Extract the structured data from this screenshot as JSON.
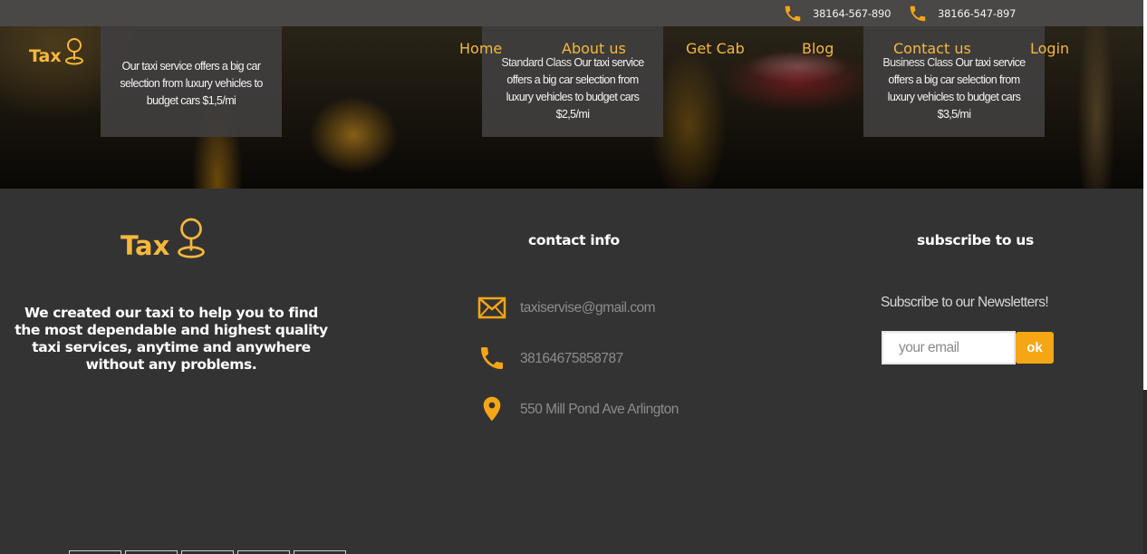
{
  "colors": {
    "accent": "#f5b83c",
    "button": "#f5a614",
    "footer_bg": "#333333",
    "topbar_bg": "#4a4747"
  },
  "topbar": {
    "phones": [
      {
        "icon": "phone-icon",
        "number": "38164-567-890"
      },
      {
        "icon": "phone-icon",
        "number": "38166-547-897"
      }
    ]
  },
  "header": {
    "logo_text": "Tax",
    "nav": [
      "Home",
      "About us",
      "Get Cab",
      "Blog",
      "Contact us",
      "Login"
    ]
  },
  "cards": [
    {
      "text": "Our taxi service offers a big car selection from luxury vehicles to budget cars $1,5/mi"
    },
    {
      "title": "Standard Class",
      "text": "Our taxi service offers a big car selection from luxury vehicles to budget cars $2,5/mi"
    },
    {
      "title": "Business Class",
      "text": "Our taxi service offers a big car selection from luxury vehicles to budget cars $3,5/mi"
    }
  ],
  "footer": {
    "logo_text": "Tax",
    "description": "We created our taxi to help you to find the most dependable and highest quality taxi services, anytime and anywhere without any problems.",
    "contact": {
      "title": "contact info",
      "email": "taxiservise@gmail.com",
      "phone": "38164675858787",
      "address": "550 Mill Pond Ave Arlington"
    },
    "subscribe": {
      "title": "subscribe to us",
      "label": "Subscribe to our Newsletters!",
      "placeholder": "your email",
      "button": "ok"
    }
  }
}
